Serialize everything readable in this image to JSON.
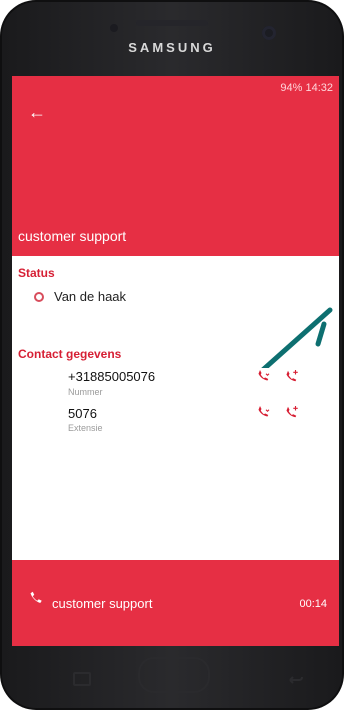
{
  "brand": "SAMSUNG",
  "statusbar": {
    "text": "94%  14:32"
  },
  "header": {
    "title": "customer support",
    "back_icon": "arrow-left-icon"
  },
  "status": {
    "heading": "Status",
    "value": "Van de haak"
  },
  "contacts": {
    "heading": "Contact gegevens",
    "items": [
      {
        "value": "+31885005076",
        "label": "Nummer"
      },
      {
        "value": "5076",
        "label": "Extensie"
      }
    ]
  },
  "callbar": {
    "label": "customer support",
    "time": "00:14"
  },
  "colors": {
    "accent": "#e62f44",
    "white": "#ffffff",
    "text": "#111111"
  }
}
